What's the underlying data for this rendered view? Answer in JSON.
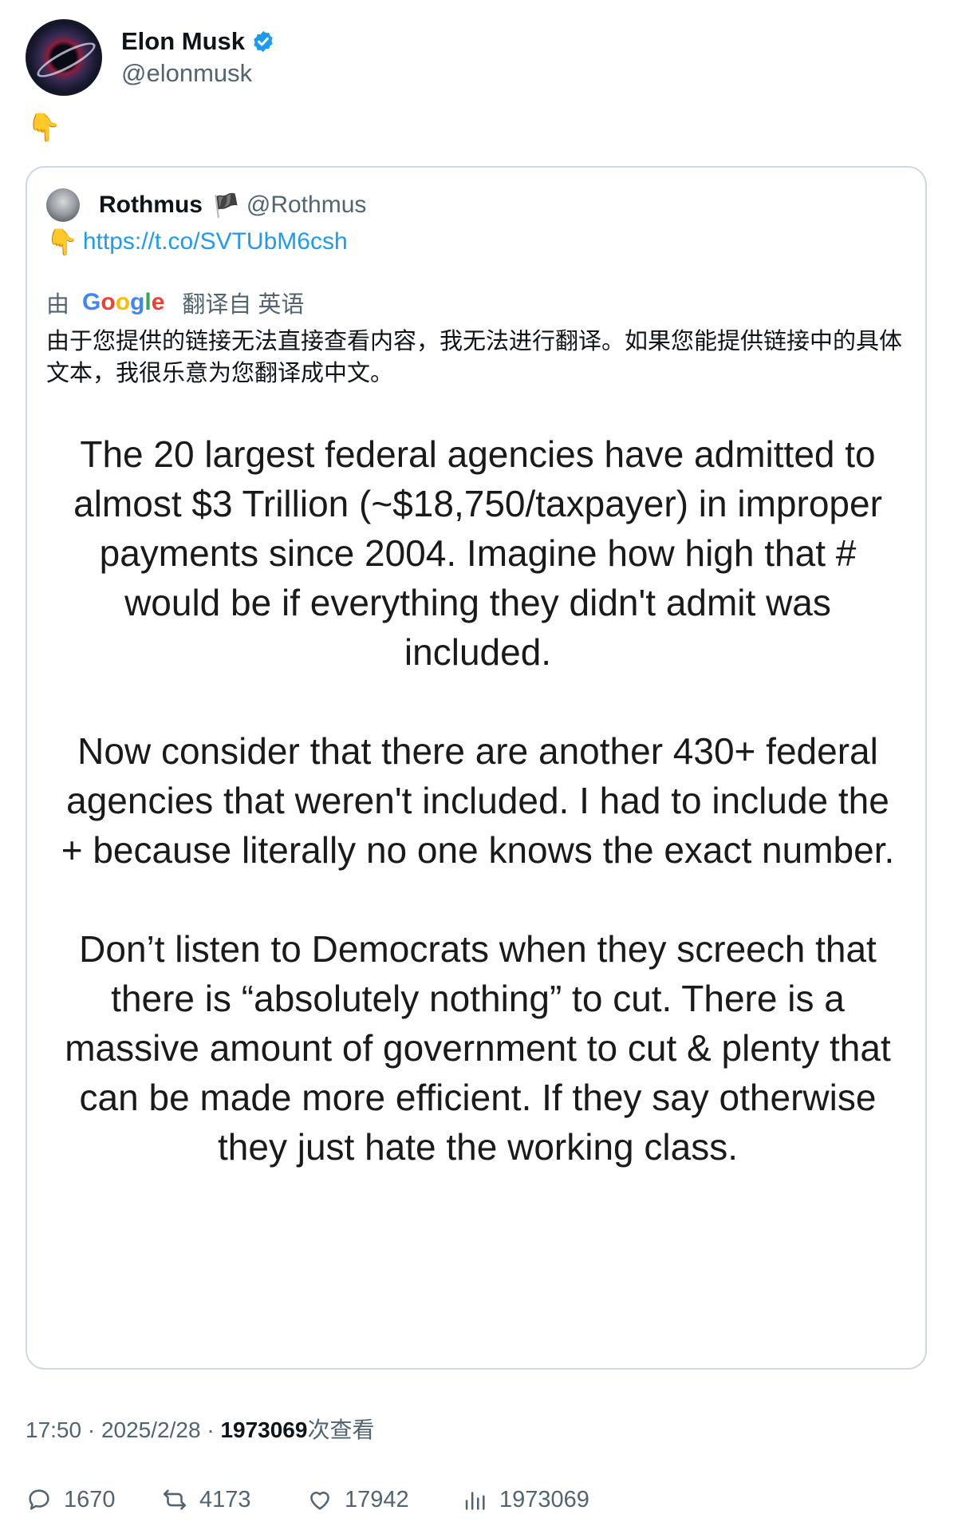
{
  "author": {
    "name": "Elon Musk",
    "handle": "@elonmusk",
    "verified_color": "#1d9bf0"
  },
  "tweet": {
    "text": "👇"
  },
  "quoted": {
    "name": "Rothmus",
    "flag": "🏴",
    "handle": "@Rothmus",
    "pointer": "👇",
    "link": "https://t.co/SVTUbM6csh",
    "translate_prefix": "由",
    "translate_suffix": "翻译自 英语",
    "translation": "由于您提供的链接无法直接查看内容，我无法进行翻译。如果您能提供链接中的具体文本，我很乐意为您翻译成中文。",
    "image_paragraphs": [
      "The 20 largest federal agencies have admitted to almost $3 Trillion (~$18,750/taxpayer) in improper payments since 2004. Imagine how high that # would be if everything they didn't admit was included.",
      "Now consider that there are another 430+ federal agencies that weren't included. I had to include the + because literally no one knows the exact number.",
      "Don’t listen to Democrats when they screech that there is “absolutely nothing” to cut. There is a massive amount of government to cut & plenty that can be made more efficient. If they say otherwise they just hate the working class."
    ]
  },
  "meta": {
    "time": "17:50",
    "date": "2025/2/28",
    "views": "1973069",
    "views_suffix": "次查看"
  },
  "actions": {
    "replies": "1670",
    "retweets": "4173",
    "likes": "17942",
    "views": "1973069"
  }
}
